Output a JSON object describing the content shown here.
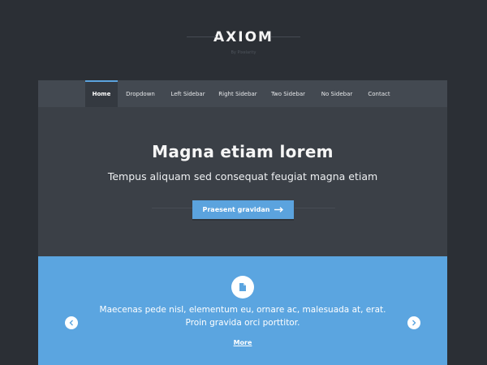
{
  "header": {
    "logo": "AXIOM",
    "byline": "By Pixelarity"
  },
  "nav": {
    "items": [
      {
        "label": "Home",
        "active": true
      },
      {
        "label": "Dropdown",
        "active": false
      },
      {
        "label": "Left Sidebar",
        "active": false
      },
      {
        "label": "Right Sidebar",
        "active": false
      },
      {
        "label": "Two Sidebar",
        "active": false
      },
      {
        "label": "No Sidebar",
        "active": false
      },
      {
        "label": "Contact",
        "active": false
      }
    ]
  },
  "hero": {
    "title": "Magna etiam lorem",
    "subtitle": "Tempus aliquam sed consequat feugiat magna etiam",
    "cta_label": "Praesent gravidan"
  },
  "features": {
    "icon": "document-icon",
    "text": "Maecenas pede nisl, elementum eu, ornare ac, malesuada at, erat. Proin gravida orci porttitor.",
    "more_label": "More"
  },
  "colors": {
    "accent": "#5ba3de",
    "page_bg": "#2b2f35",
    "panel_bg": "#3b4047",
    "nav_bg": "#434951"
  }
}
